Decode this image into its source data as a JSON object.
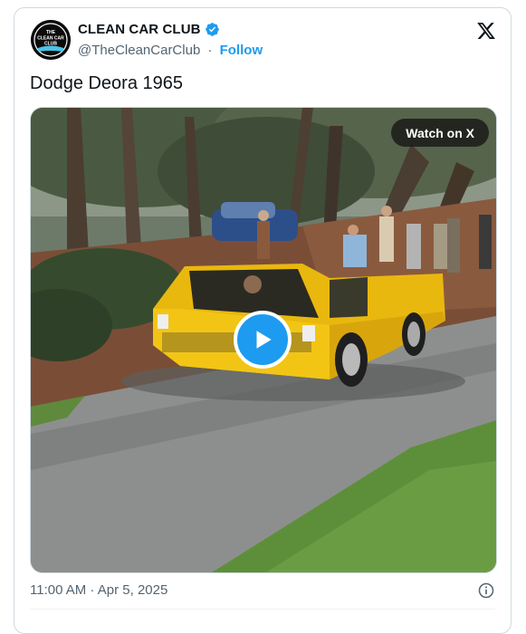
{
  "author": {
    "display_name": "CLEAN CAR CLUB",
    "handle": "@TheCleanCarClub",
    "separator": "·",
    "follow_label": "Follow",
    "avatar_text": [
      "THE",
      "CLEAN CAR",
      "CLUB"
    ]
  },
  "tweet": {
    "text": "Dodge Deora 1965",
    "timestamp": "11:00 AM · Apr 5, 2025"
  },
  "media": {
    "watch_label": "Watch on X"
  },
  "icons": {
    "verified": "verified-badge-icon",
    "x_logo": "x-logo-icon",
    "play": "play-icon",
    "info": "info-icon"
  },
  "colors": {
    "accent": "#1d9bf0",
    "text": "#0f1419",
    "secondary_text": "#536471",
    "border": "#cfd9de",
    "car": "#f2c515"
  }
}
